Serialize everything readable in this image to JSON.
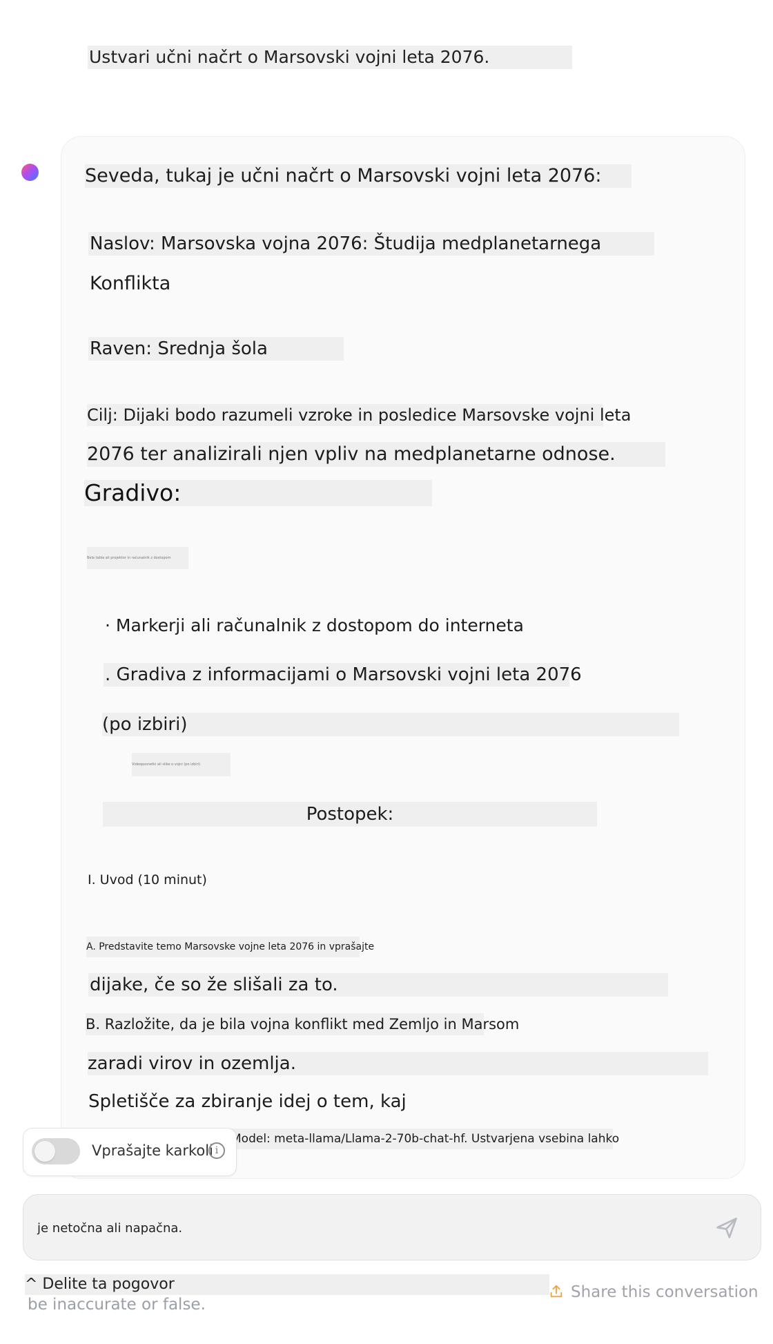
{
  "user_message": "Ustvari učni načrt o Marsovski vojni leta 2076.",
  "assistant": {
    "intro": "Seveda, tukaj je učni načrt o Marsovski vojni leta 2076:",
    "title_line1": "Naslov: Marsovska vojna 2076: Študija medplanetarnega",
    "title_line2": "Konflikta",
    "level": "Raven: Srednja šola",
    "goal_line1": "Cilj: Dijaki bodo razumeli vzroke in posledice Marsovske vojni leta",
    "goal_line2": "2076 ter analizirali njen vpliv na medplanetarne odnose.",
    "materials_heading": "Gradivo:",
    "materials_tiny": "Bela tabla ali projektor in računalnik z dostopom",
    "item1": "· Markerji ali računalnik z dostopom do interneta",
    "item2": ". Gradiva z informacijami o Marsovski vojni leta 2076",
    "item3": "(po izbiri)",
    "item3_tiny": "Videoposnetki ali slike o vojni (po izbiri)",
    "procedure_heading": "Postopek:",
    "section1": "I. Uvod (10 minut)",
    "stepA_line1": "A. Predstavite temo Marsovske vojne leta 2076 in vprašajte",
    "stepA_line2": "dijake, če so že slišali za to.",
    "stepB_line1": "B. Razložite, da je bila vojna konflikt med Zemljo in Marsom",
    "stepB_line2": "zaradi virov in ozemlja.",
    "stepC": "Spletišče za zbiranje idej o tem, kaj"
  },
  "toggle": {
    "label": "Vprašajte karkoli",
    "on": false
  },
  "model_notice": "Model: meta-llama/Llama-2-70b-chat-hf. Ustvarjena vsebina lahko",
  "composer": {
    "text": "je netočna ali napačna."
  },
  "footer": {
    "delete": "^ Delite ta pogovor",
    "disclaimer": "be inaccurate or false.",
    "share": "Share this conversation"
  },
  "colors": {
    "accent": "#f0a33a",
    "highlight": "#efefef"
  },
  "icons": {
    "info": "info-icon",
    "send": "send-icon",
    "share": "share-icon"
  }
}
